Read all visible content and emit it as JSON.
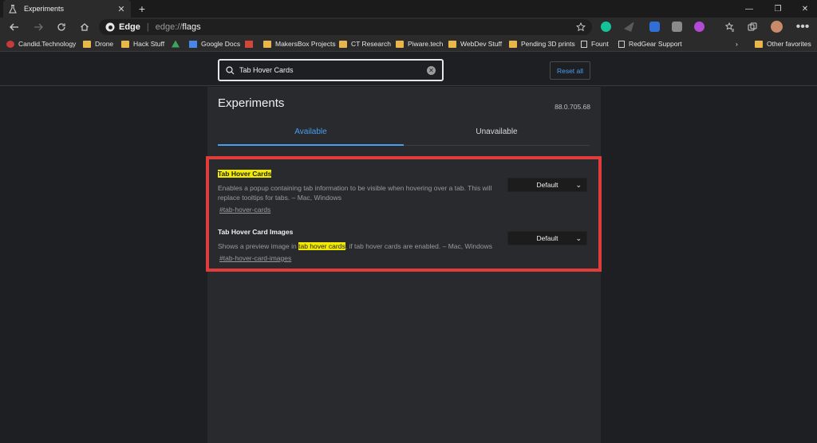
{
  "browser": {
    "tab_title": "Experiments",
    "address": {
      "site": "Edge",
      "scheme": "edge://",
      "path": "flags"
    }
  },
  "bookmarks": [
    "Candid.Technology",
    "Drone",
    "Hack Stuff",
    "Google Docs",
    "MakersBox Projects",
    "CT Research",
    "Piware.tech",
    "WebDev Stuff",
    "Pending 3D prints",
    "Fount",
    "RedGear Support"
  ],
  "bookmarks_other": "Other favorites",
  "search": {
    "value": "Tab Hover Cards"
  },
  "reset_label": "Reset all",
  "page": {
    "title": "Experiments",
    "version": "88.0.705.68",
    "tabs": {
      "available": "Available",
      "unavailable": "Unavailable"
    }
  },
  "flags": [
    {
      "title": "Tab Hover Cards",
      "desc": "Enables a popup containing tab information to be visible when hovering over a tab. This will replace tooltips for tabs. – Mac, Windows",
      "link": "#tab-hover-cards",
      "value": "Default"
    },
    {
      "title": "Tab Hover Card Images",
      "desc_pre": "Shows a preview image in ",
      "desc_hl": "tab hover cards",
      "desc_post": ", if tab hover cards are enabled. – Mac, Windows",
      "link": "#tab-hover-card-images",
      "value": "Default"
    }
  ],
  "colors": {
    "accent": "#4a9ef0",
    "highlight": "#f2ea00",
    "annotation": "#e03c3c"
  }
}
